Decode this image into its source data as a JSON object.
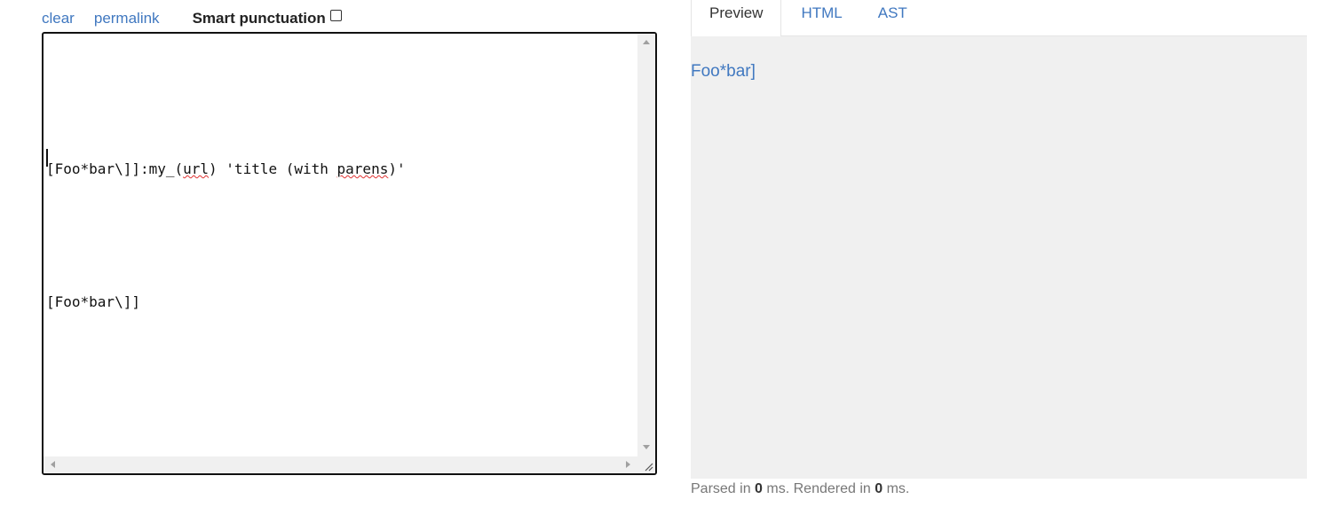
{
  "toolbar": {
    "clear_label": "clear",
    "permalink_label": "permalink",
    "smart_punctuation_label": "Smart punctuation",
    "smart_punctuation_checked": false
  },
  "editor": {
    "line1_pre": "[Foo*bar\\]]:my_(",
    "line1_word1": "url",
    "line1_mid": ") 'title (with ",
    "line1_word2": "parens",
    "line1_post": ")'",
    "line2": "[Foo*bar\\]]",
    "line3": ""
  },
  "tabs": [
    {
      "label": "Preview",
      "active": true
    },
    {
      "label": "HTML",
      "active": false
    },
    {
      "label": "AST",
      "active": false
    }
  ],
  "preview": {
    "link_text": "Foo*bar]"
  },
  "status": {
    "parsed_prefix": "Parsed in ",
    "parsed_ms": "0",
    "rendered_prefix": " ms. Rendered in ",
    "rendered_ms": "0",
    "suffix": " ms."
  },
  "colors": {
    "link": "#4078c0",
    "preview_bg": "#f0f0f0",
    "spellcheck": "#e03030"
  }
}
